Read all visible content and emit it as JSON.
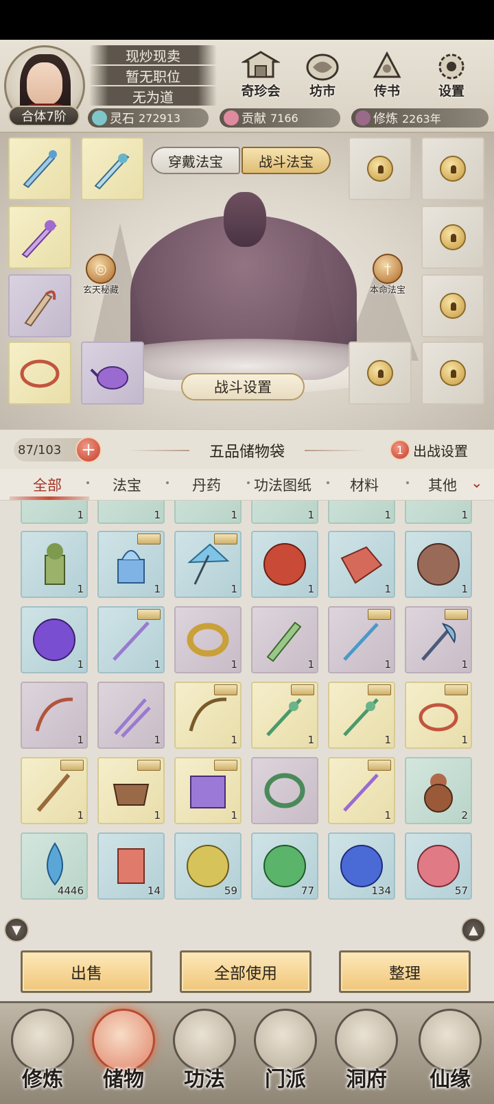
{
  "header": {
    "titles": [
      "现炒现卖",
      "暂无职位",
      "无为道"
    ],
    "realm": "合体7阶",
    "top_buttons": [
      {
        "label": "奇珍会",
        "icon": "pavilion-icon"
      },
      {
        "label": "坊市",
        "icon": "market-icon"
      },
      {
        "label": "传书",
        "icon": "letter-icon"
      },
      {
        "label": "设置",
        "icon": "gear-icon"
      }
    ],
    "resources": [
      {
        "label": "灵石",
        "value": "272913",
        "icon": "spirit-stone-icon",
        "color": "#7fc6c9"
      },
      {
        "label": "贡献",
        "value": "7166",
        "icon": "contribution-icon",
        "color": "#e08aa0"
      },
      {
        "label": "修炼",
        "value": "2263年",
        "icon": "cultivation-icon",
        "color": "#9a6a8a"
      }
    ]
  },
  "equipment": {
    "tabs": {
      "wear": "穿戴法宝",
      "battle": "战斗法宝",
      "active": "battle"
    },
    "left_badge": "玄天秘藏",
    "right_badge": "本命法宝",
    "battle_settings": "战斗设置"
  },
  "bag": {
    "capacity": "87/103",
    "title": "五品储物袋",
    "deploy_count": "1",
    "deploy_label": "出战设置"
  },
  "categories": {
    "items": [
      "全部",
      "法宝",
      "丹药",
      "功法图纸",
      "材料",
      "其他"
    ],
    "active": 0
  },
  "grid": {
    "partial_row_qty": [
      "1",
      "1",
      "1",
      "1",
      "1",
      "1"
    ],
    "rows": [
      [
        "1",
        "1",
        "1",
        "1",
        "1",
        "1"
      ],
      [
        "1",
        "1",
        "1",
        "1",
        "1",
        "1"
      ],
      [
        "1",
        "1",
        "1",
        "1",
        "1",
        "1"
      ],
      [
        "1",
        "1",
        "1",
        "",
        "1",
        "2"
      ],
      [
        "4446",
        "14",
        "59",
        "77",
        "134",
        "57"
      ]
    ]
  },
  "actions": {
    "sell": "出售",
    "use_all": "全部使用",
    "sort": "整理"
  },
  "nav": {
    "items": [
      "修炼",
      "储物",
      "功法",
      "门派",
      "洞府",
      "仙缘"
    ],
    "active": 1
  },
  "colors": {
    "accent_red": "#c23b2b",
    "gold_button": "#f0c67a",
    "active_tab_text": "#a23324"
  }
}
